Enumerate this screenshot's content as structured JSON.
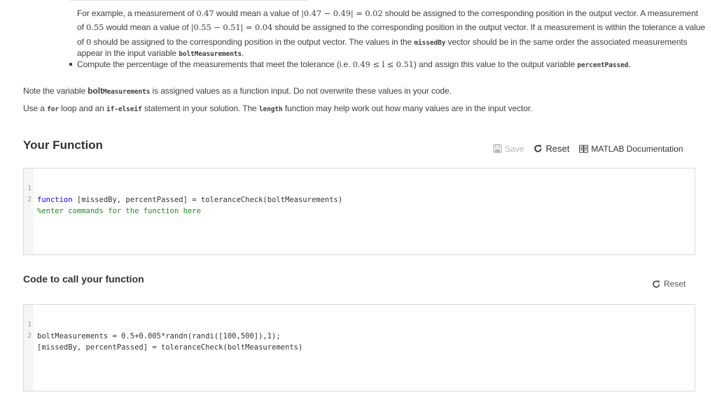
{
  "problem": {
    "p1": {
      "t1": "For example, a measurement of ",
      "m1": "0.47",
      "t2": " would mean a value of ",
      "m2": "|0.47 − 0.49| = 0.02",
      "t3": " should be assigned to the corresponding position in the output vector.  A measurement"
    },
    "p2": {
      "t1": "of ",
      "m1": "0.55",
      "t2": " would mean a value of  ",
      "m2": "|0.55 − 0.51| = 0.04",
      "t3": " should be assigned to the corresponding position in the output vector. If a measurement is within the tolerance a value"
    },
    "p3": {
      "t1": "of ",
      "m1": "0",
      "t2": " should be assigned to the corresponding position in the output vector. The values in the ",
      "code1": "missedBy",
      "t3": " vector should be in the same order the associated measurements"
    },
    "p4": {
      "t1": "appear in the input variable ",
      "code1": "boltMeasurements",
      "t2": "."
    },
    "bullet": {
      "t1": "Compute the percentage of the measurements that meet the tolerance (i.e. ",
      "m1": "0.49 ≤ l ≤ 0.51",
      "t2": ") and assign this value to the output variable ",
      "code1": "percentPassed",
      "t3": "."
    },
    "note": {
      "t1": "Note the variable ",
      "bold1": "bolt",
      "code1": "Measurements",
      "t2": " is assigned values as a function input. Do not overwrite these values in your code."
    },
    "use": {
      "t1": "Use a ",
      "code1": "for",
      "t2": " loop and an ",
      "code2": "if-elseif",
      "t3": " statement in your solution. The ",
      "code3": "length",
      "t4": " function may help work out how many values are in the input vector."
    }
  },
  "your_function": {
    "title": "Your Function",
    "toolbar": {
      "save": "Save",
      "reset": "Reset",
      "docs": "MATLAB Documentation",
      "icons": [
        "save-icon",
        "reset-icon",
        "documentation-icon"
      ]
    },
    "lines": [
      {
        "num": "1",
        "kw": "function",
        "rest": " [missedBy, percentPassed] = toleranceCheck(boltMeasurements)"
      },
      {
        "num": "2",
        "comment": "%enter commands for the function here"
      }
    ]
  },
  "call_function": {
    "title": "Code to call your function",
    "reset": "Reset",
    "lines": [
      {
        "num": "1",
        "text": "boltMeasurements = 0.5+0.005*randn(randi([100,500]),1);"
      },
      {
        "num": "2",
        "text": "[missedBy, percentPassed] = toleranceCheck(boltMeasurements)"
      }
    ]
  },
  "colors": {
    "text": "#404040",
    "keyword": "#0e00ff",
    "comment": "#228b22",
    "line_number": "#9a9a9a",
    "disabled": "#b5b5b5"
  }
}
